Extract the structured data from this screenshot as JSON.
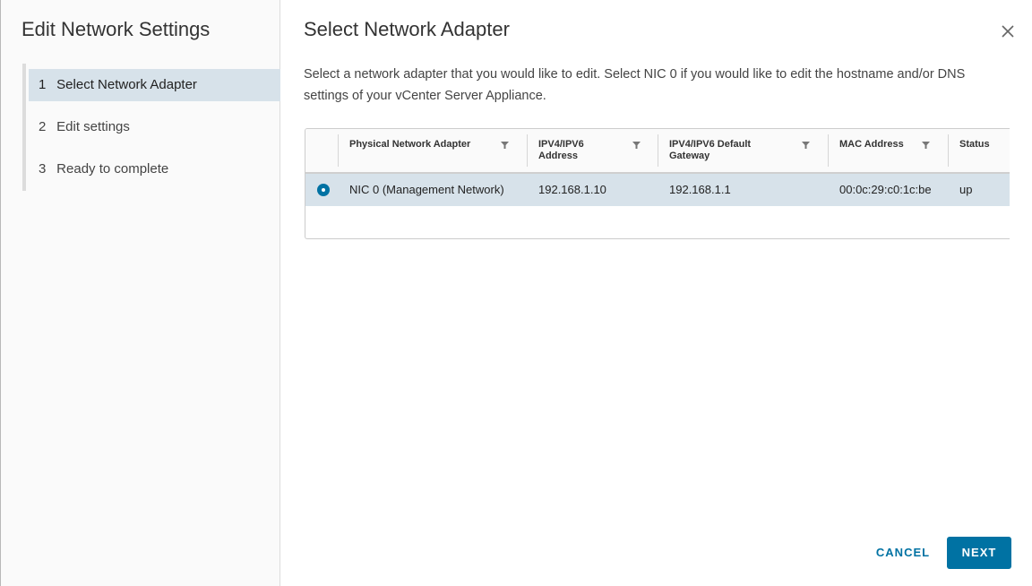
{
  "sidebar": {
    "title": "Edit Network Settings",
    "steps": [
      {
        "num": "1",
        "label": "Select Network Adapter",
        "active": true
      },
      {
        "num": "2",
        "label": "Edit settings",
        "active": false
      },
      {
        "num": "3",
        "label": "Ready to complete",
        "active": false
      }
    ]
  },
  "main": {
    "title": "Select Network Adapter",
    "description": "Select a network adapter that you would like to edit. Select NIC 0 if you would like to edit the hostname and/or DNS settings of your vCenter Server Appliance.",
    "close_icon": "close-icon"
  },
  "table": {
    "headers": {
      "adapter": "Physical Network Adapter",
      "address": "IPV4/IPV6 Address",
      "gateway": "IPV4/IPV6 Default Gateway",
      "mac": "MAC Address",
      "status": "Status"
    },
    "rows": [
      {
        "selected": true,
        "adapter": "NIC 0 (Management Network)",
        "address": "192.168.1.10",
        "gateway": "192.168.1.1",
        "mac": "00:0c:29:c0:1c:be",
        "status": "up"
      }
    ]
  },
  "footer": {
    "cancel_label": "CANCEL",
    "next_label": "NEXT"
  },
  "colors": {
    "accent": "#0072a3",
    "selected_row": "#d7e2ea"
  }
}
